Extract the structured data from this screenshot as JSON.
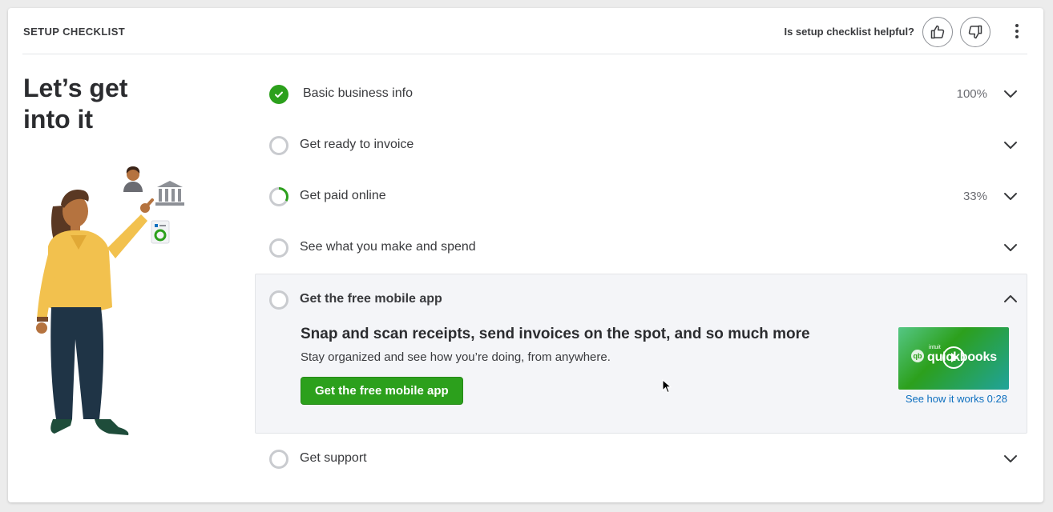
{
  "header": {
    "title": "SETUP CHECKLIST",
    "helpful_question": "Is setup checklist helpful?"
  },
  "hero": {
    "title_line1": "Let’s get",
    "title_line2": "into it"
  },
  "checklist": [
    {
      "label": "Basic business info",
      "status": "complete",
      "percent": "100%",
      "progress": 1.0
    },
    {
      "label": "Get ready to invoice",
      "status": "not-started",
      "percent": "",
      "progress": 0.0
    },
    {
      "label": "Get paid online",
      "status": "in-progress",
      "percent": "33%",
      "progress": 0.33
    },
    {
      "label": "See what you make and spend",
      "status": "not-started",
      "percent": "",
      "progress": 0.0
    },
    {
      "label": "Get the free mobile app",
      "status": "not-started",
      "percent": "",
      "progress": 0.0,
      "expanded": true
    },
    {
      "label": "Get support",
      "status": "not-started",
      "percent": "",
      "progress": 0.0
    }
  ],
  "mobile_app": {
    "headline": "Snap and scan receipts, send invoices on the spot, and so much more",
    "subtext": "Stay organized and see how you’re doing, from anywhere.",
    "cta_label": "Get the free mobile app",
    "video_brand": "quickbooks",
    "video_brand_prefix": "intuit",
    "video_logo": "qb",
    "video_link": "See how it works 0:28"
  },
  "colors": {
    "brand_green": "#2ca01c",
    "link_blue": "#0d6fbf",
    "text_dark": "#393a3d",
    "empty_circle": "#c9cbcf"
  },
  "icons": [
    "thumbs-up-icon",
    "thumbs-down-icon",
    "more-vertical-icon",
    "check-icon",
    "chevron-down-icon",
    "chevron-up-icon",
    "play-icon"
  ]
}
